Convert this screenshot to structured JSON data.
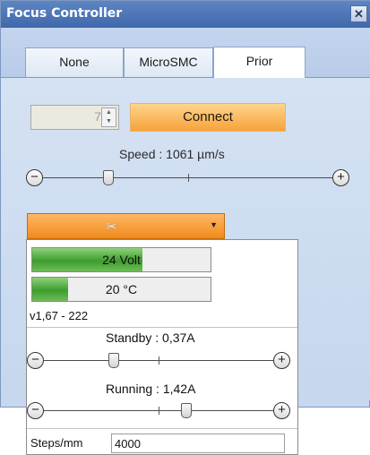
{
  "window": {
    "title": "Focus Controller",
    "close_symbol": "✕"
  },
  "tabs": [
    {
      "label": "None",
      "active": false
    },
    {
      "label": "MicroSMC",
      "active": false
    },
    {
      "label": "Prior",
      "active": true
    }
  ],
  "controls": {
    "port_value": "7",
    "connect_label": "Connect",
    "speed_label": "Speed : 1061 µm/s",
    "speed_level": 0.23
  },
  "settings_dropdown": {
    "icon": "wrench-icon"
  },
  "popup": {
    "voltage_label": "24 Volt",
    "voltage_level": 0.62,
    "temperature_label": "20 °C",
    "temperature_level": 0.2,
    "version": "v1,67 - 222",
    "standby_label": "Standby : 0,37A",
    "standby_level": 0.31,
    "running_label": "Running : 1,42A",
    "running_level": 0.62,
    "steps_label": "Steps/mm",
    "steps_value": "4000"
  },
  "colors": {
    "accent_orange": "#f6a33a",
    "titlebar_blue": "#4a73b6",
    "panel_blue": "#c6d7ee",
    "bar_green": "#3e9d2d"
  }
}
